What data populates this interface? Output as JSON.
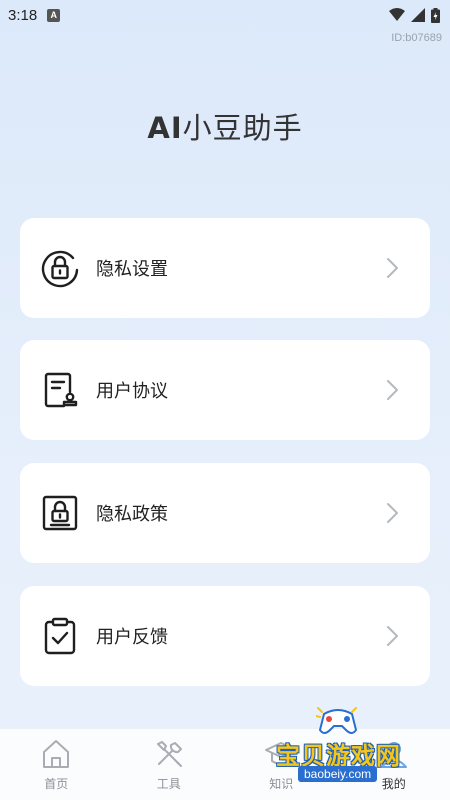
{
  "status_bar": {
    "time": "3:18",
    "badge": "A"
  },
  "id_label": "ID:b07689",
  "title": {
    "prefix": "AI",
    "rest": "小豆助手"
  },
  "menu": [
    {
      "label": "隐私设置",
      "icon": "lock-circle-icon"
    },
    {
      "label": "用户协议",
      "icon": "document-stamp-icon"
    },
    {
      "label": "隐私政策",
      "icon": "lock-document-icon"
    },
    {
      "label": "用户反馈",
      "icon": "clipboard-check-icon"
    }
  ],
  "tabs": [
    {
      "label": "首页",
      "icon": "home-icon"
    },
    {
      "label": "工具",
      "icon": "tools-icon"
    },
    {
      "label": "知识",
      "icon": "graduation-cap-icon"
    },
    {
      "label": "我的",
      "icon": "profile-icon"
    }
  ],
  "watermark": {
    "text": "宝贝游戏网",
    "url": "baobeiy.com"
  }
}
